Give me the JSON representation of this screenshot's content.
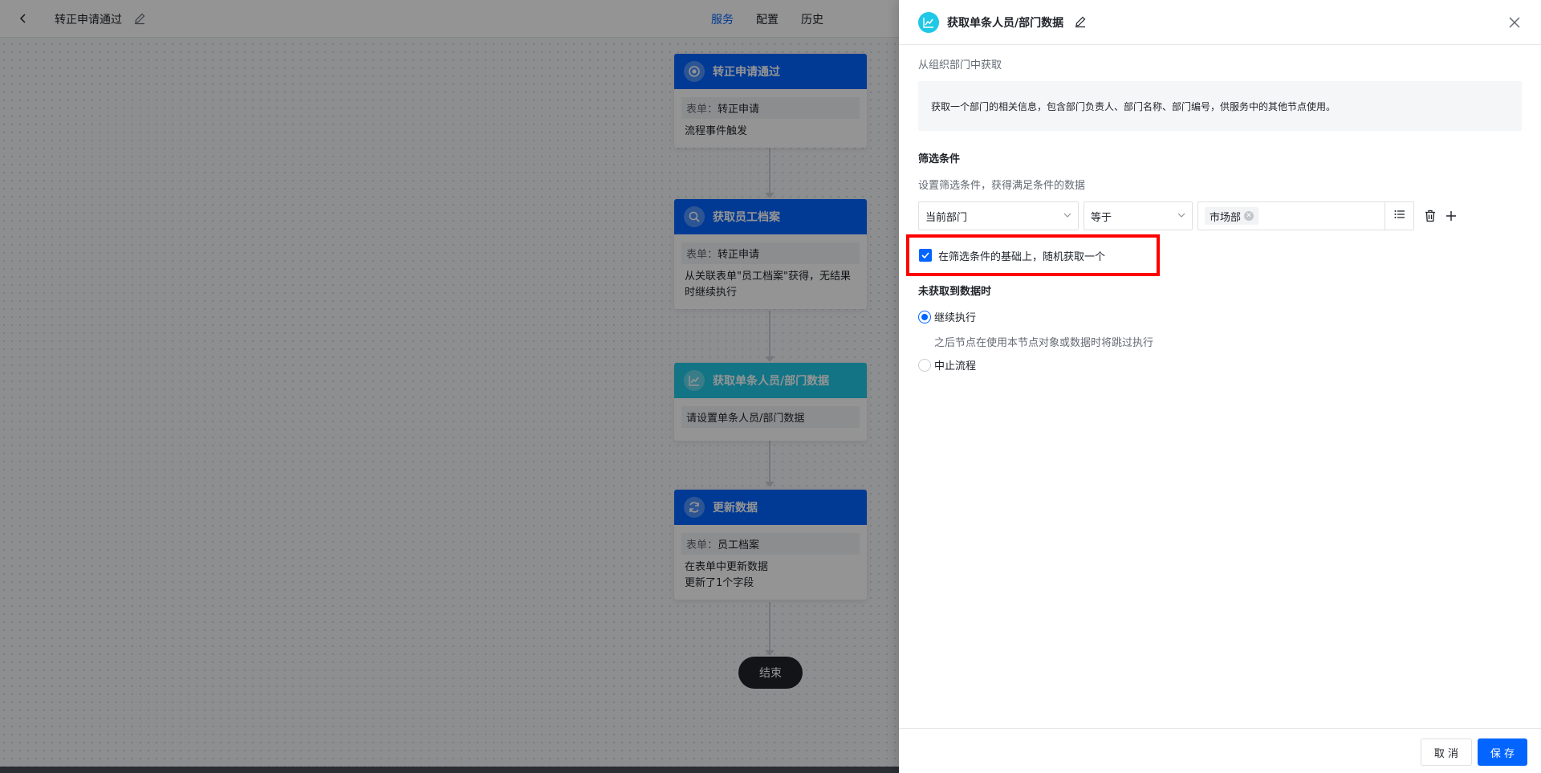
{
  "topbar": {
    "title": "转正申请通过",
    "tabs": [
      {
        "label": "服务",
        "active": true
      },
      {
        "label": "配置",
        "active": false
      },
      {
        "label": "历史",
        "active": false
      }
    ]
  },
  "flow": {
    "nodes": [
      {
        "title": "转正申请通过",
        "icon": "target-icon",
        "tag_label": "表单：",
        "tag_value": "转正申请",
        "lines": [
          "流程事件触发"
        ]
      },
      {
        "title": "获取员工档案",
        "icon": "search-icon",
        "tag_label": "表单：",
        "tag_value": "转正申请",
        "lines": [
          "从关联表单\"员工档案\"获得，无结果",
          "时继续执行"
        ]
      },
      {
        "title": "获取单条人员/部门数据",
        "icon": "chart-line-icon",
        "tag_label": "",
        "tag_value": "请设置单条人员/部门数据",
        "lines": []
      },
      {
        "title": "更新数据",
        "icon": "refresh-icon",
        "tag_label": "表单：",
        "tag_value": "员工档案",
        "lines": [
          "在表单中更新数据",
          "更新了1个字段"
        ]
      }
    ],
    "end_label": "结束"
  },
  "drawer": {
    "title": "获取单条人员/部门数据",
    "source_label": "从组织部门中获取",
    "description": "获取一个部门的相关信息，包含部门负责人、部门名称、部门编号，供服务中的其他节点使用。",
    "filter": {
      "section_title": "筛选条件",
      "hint": "设置筛选条件，获得满足条件的数据",
      "field": "当前部门",
      "operator": "等于",
      "value_chip": "市场部"
    },
    "random_option": {
      "label": "在筛选条件的基础上，随机获取一个",
      "checked": true
    },
    "empty_section": {
      "title": "未获取到数据时",
      "options": [
        {
          "label": "继续执行",
          "checked": true,
          "note": "之后节点在使用本节点对象或数据时将跳过执行"
        },
        {
          "label": "中止流程",
          "checked": false
        }
      ]
    },
    "footer": {
      "cancel_label": "取 消",
      "save_label": "保 存"
    }
  },
  "colors": {
    "primary": "#0265ff",
    "node_cyan": "#1fc8e6",
    "highlight_border": "#ff0000"
  }
}
